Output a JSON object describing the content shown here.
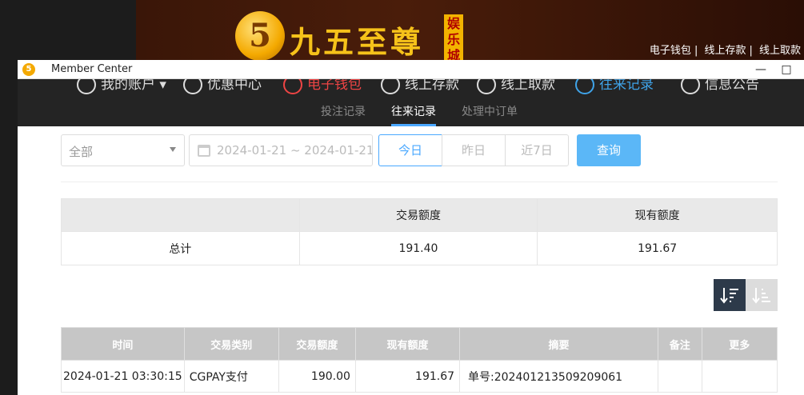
{
  "site": {
    "logo_glyph": "5",
    "brand_name": "九五至尊",
    "brand_tag": "娱乐城",
    "top_links": [
      "电子钱包",
      "线上存款",
      "线上取款"
    ]
  },
  "window": {
    "title": "Member Center",
    "minimize": "—",
    "maximize": "□"
  },
  "main_nav": [
    {
      "label": "我的账户 ▾",
      "state": "normal"
    },
    {
      "label": "优惠中心",
      "state": "normal"
    },
    {
      "label": "电子钱包",
      "state": "highlight"
    },
    {
      "label": "线上存款",
      "state": "normal"
    },
    {
      "label": "线上取款",
      "state": "normal"
    },
    {
      "label": "往来记录",
      "state": "active"
    },
    {
      "label": "信息公告",
      "state": "normal"
    }
  ],
  "sub_nav": {
    "bet_records": "投注记录",
    "transactions": "往来记录",
    "pending_orders": "处理中订单"
  },
  "filters": {
    "type_select": "全部",
    "date_range": "2024-01-21 ~ 2024-01-21",
    "today": "今日",
    "yesterday": "昨日",
    "last7": "近7日",
    "query": "查询"
  },
  "summary": {
    "col_amount": "交易额度",
    "col_balance": "现有额度",
    "row_label": "总计",
    "amount": "191.40",
    "balance": "191.67"
  },
  "detail": {
    "headers": [
      "时间",
      "交易类别",
      "交易额度",
      "现有额度",
      "摘要",
      "备注",
      "更多"
    ],
    "rows": [
      {
        "time": "2024-01-21 03:30:15",
        "type": "CGPAY支付",
        "amount": "190.00",
        "balance": "191.67",
        "summary": "单号:202401213509209061",
        "note": "",
        "more": ""
      }
    ]
  },
  "colors": {
    "accent": "#4aa8ff",
    "query_button": "#5bb7f7",
    "nav_bg": "#242424",
    "brand_gold": "#f6c21a"
  }
}
